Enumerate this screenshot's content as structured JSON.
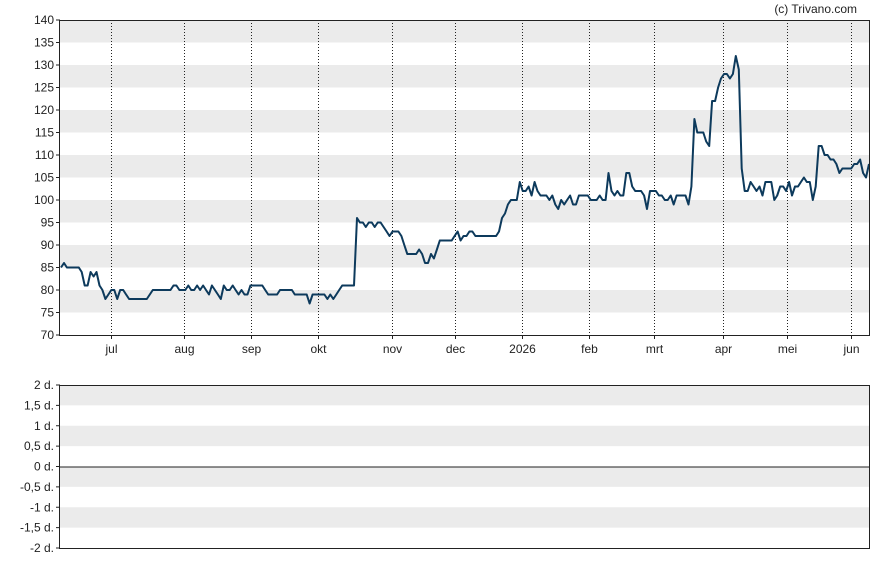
{
  "credit": "(c) Trivano.com",
  "chart_data": [
    {
      "type": "line",
      "ylim": [
        70,
        140
      ],
      "y_ticks": [
        70,
        75,
        80,
        85,
        90,
        95,
        100,
        105,
        110,
        115,
        120,
        125,
        130,
        135,
        140
      ],
      "x_ticks": [
        "jul",
        "aug",
        "sep",
        "okt",
        "nov",
        "dec",
        "2026",
        "feb",
        "mrt",
        "apr",
        "mei",
        "jun"
      ],
      "grid": "alternating horizontal bands, dotted vertical month lines",
      "line_color": "#0d3a5c",
      "series": [
        {
          "values": [
            85,
            86,
            85,
            85,
            85,
            85,
            85,
            84,
            81,
            81,
            84,
            83,
            84,
            81,
            80,
            78,
            79,
            80,
            80,
            78,
            80,
            80,
            79,
            78,
            78,
            78,
            78,
            78,
            78,
            78,
            79,
            80,
            80,
            80,
            80,
            80,
            80,
            80,
            81,
            81,
            80,
            80,
            80,
            81,
            80,
            80,
            81,
            80,
            81,
            80,
            79,
            81,
            80,
            79,
            78,
            81,
            80,
            80,
            81,
            80,
            79,
            80,
            79,
            79,
            81,
            81,
            81,
            81,
            81,
            80,
            79,
            79,
            79,
            79,
            80,
            80,
            80,
            80,
            80,
            79,
            79,
            79,
            79,
            79,
            77,
            79,
            79,
            79,
            79,
            79,
            78,
            79,
            78,
            79,
            80,
            81,
            81,
            81,
            81,
            81,
            96,
            95,
            95,
            94,
            95,
            95,
            94,
            95,
            95,
            94,
            93,
            92,
            93,
            93,
            93,
            92,
            90,
            88,
            88,
            88,
            88,
            89,
            88,
            86,
            86,
            88,
            87,
            89,
            91,
            91,
            91,
            91,
            91,
            92,
            93,
            91,
            92,
            92,
            93,
            93,
            92,
            92,
            92,
            92,
            92,
            92,
            92,
            92,
            93,
            96,
            97,
            99,
            100,
            100,
            100,
            104,
            102,
            102,
            103,
            101,
            104,
            102,
            101,
            101,
            101,
            100,
            101,
            99,
            98,
            100,
            99,
            100,
            101,
            99,
            99,
            101,
            101,
            101,
            101,
            100,
            100,
            100,
            101,
            100,
            100,
            106,
            102,
            101,
            102,
            101,
            101,
            106,
            106,
            103,
            102,
            102,
            102,
            101,
            98,
            102,
            102,
            102,
            101,
            101,
            100,
            100,
            101,
            99,
            101,
            101,
            101,
            101,
            99,
            103,
            118,
            115,
            115,
            115,
            113,
            112,
            122,
            122,
            125,
            127,
            128,
            128,
            127,
            128,
            132,
            129,
            107,
            102,
            102,
            104,
            103,
            102,
            103,
            101,
            104,
            104,
            104,
            100,
            101,
            103,
            103,
            102,
            104,
            101,
            103,
            103,
            104,
            105,
            104,
            104,
            100,
            103,
            112,
            112,
            110,
            110,
            109,
            109,
            108,
            106,
            107,
            107,
            107,
            107,
            108,
            108,
            109,
            106,
            105,
            108
          ]
        }
      ]
    },
    {
      "type": "line",
      "ylim": [
        -2,
        2
      ],
      "y_ticks": [
        "2 d.",
        "1,5 d.",
        "1 d.",
        "0,5 d.",
        "0 d.",
        "-0,5 d.",
        "-1 d.",
        "-1,5 d.",
        "-2 d."
      ],
      "x_ticks": [],
      "grid": "alternating horizontal bands",
      "series": [
        {
          "values": [
            0,
            0
          ]
        }
      ]
    }
  ]
}
